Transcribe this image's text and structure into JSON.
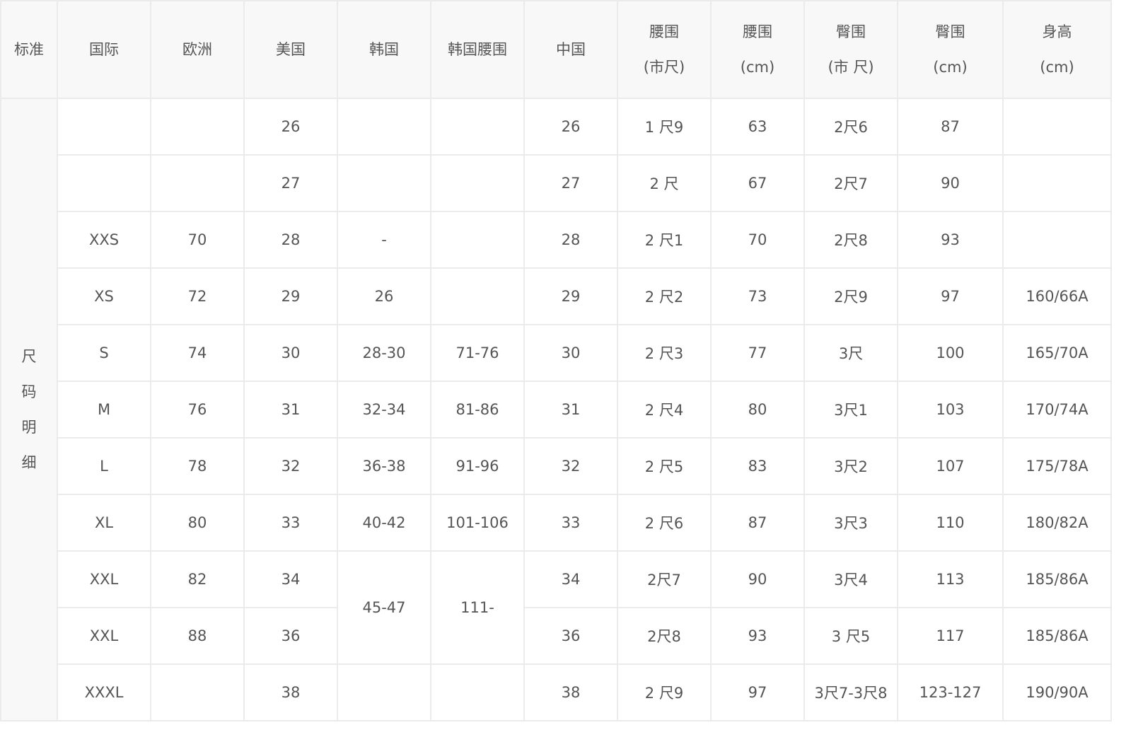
{
  "headers": [
    {
      "line1": "标准"
    },
    {
      "line1": "国际"
    },
    {
      "line1": "欧洲"
    },
    {
      "line1": "美国"
    },
    {
      "line1": "韩国"
    },
    {
      "line1": "韩国腰围"
    },
    {
      "line1": "中国"
    },
    {
      "line1": "腰围",
      "line2": "(市尺)"
    },
    {
      "line1": "腰围",
      "line2": "(cm)"
    },
    {
      "line1": "臀围",
      "line2": "(市 尺)"
    },
    {
      "line1": "臀围",
      "line2": "(cm)"
    },
    {
      "line1": "身高",
      "line2": "(cm)"
    }
  ],
  "side_label": [
    "尺",
    "码",
    "明",
    "细"
  ],
  "rows": [
    {
      "intl": "",
      "eu": "",
      "us": "26",
      "kr": "",
      "kr_waist": "",
      "cn": "26",
      "waist_chi": "1 尺9",
      "waist_cm": "63",
      "hip_chi": "2尺6",
      "hip_cm": "87",
      "height": ""
    },
    {
      "intl": "",
      "eu": "",
      "us": "27",
      "kr": "",
      "kr_waist": "",
      "cn": "27",
      "waist_chi": "2 尺",
      "waist_cm": "67",
      "hip_chi": "2尺7",
      "hip_cm": "90",
      "height": ""
    },
    {
      "intl": "XXS",
      "eu": "70",
      "us": "28",
      "kr": "-",
      "kr_waist": "",
      "cn": "28",
      "waist_chi": "2 尺1",
      "waist_cm": "70",
      "hip_chi": "2尺8",
      "hip_cm": "93",
      "height": ""
    },
    {
      "intl": "XS",
      "eu": "72",
      "us": "29",
      "kr": "26",
      "kr_waist": "",
      "cn": "29",
      "waist_chi": "2 尺2",
      "waist_cm": "73",
      "hip_chi": "2尺9",
      "hip_cm": "97",
      "height": "160/66A"
    },
    {
      "intl": "S",
      "eu": "74",
      "us": "30",
      "kr": "28-30",
      "kr_waist": "71-76",
      "cn": "30",
      "waist_chi": "2 尺3",
      "waist_cm": "77",
      "hip_chi": "3尺",
      "hip_cm": "100",
      "height": "165/70A"
    },
    {
      "intl": "M",
      "eu": "76",
      "us": "31",
      "kr": "32-34",
      "kr_waist": "81-86",
      "cn": "31",
      "waist_chi": "2 尺4",
      "waist_cm": "80",
      "hip_chi": "3尺1",
      "hip_cm": "103",
      "height": "170/74A"
    },
    {
      "intl": "L",
      "eu": "78",
      "us": "32",
      "kr": "36-38",
      "kr_waist": "91-96",
      "cn": "32",
      "waist_chi": "2 尺5",
      "waist_cm": "83",
      "hip_chi": "3尺2",
      "hip_cm": "107",
      "height": "175/78A"
    },
    {
      "intl": "XL",
      "eu": "80",
      "us": "33",
      "kr": "40-42",
      "kr_waist": "101-106",
      "cn": "33",
      "waist_chi": "2 尺6",
      "waist_cm": "87",
      "hip_chi": "3尺3",
      "hip_cm": "110",
      "height": "180/82A"
    },
    {
      "intl": "XXL",
      "eu": "82",
      "us": "34",
      "kr": "45-47",
      "kr_waist": "111-",
      "cn": "34",
      "waist_chi": "2尺7",
      "waist_cm": "90",
      "hip_chi": "3尺4",
      "hip_cm": "113",
      "height": "185/86A"
    },
    {
      "intl": "XXL",
      "eu": "88",
      "us": "36",
      "cn": "36",
      "waist_chi": "2尺8",
      "waist_cm": "93",
      "hip_chi": "3 尺5",
      "hip_cm": "117",
      "height": "185/86A"
    },
    {
      "intl": "XXXL",
      "eu": "",
      "us": "38",
      "kr": "",
      "kr_waist": "",
      "cn": "38",
      "waist_chi": "2 尺9",
      "waist_cm": "97",
      "hip_chi": "3尺7-3尺8",
      "hip_cm": "123-127",
      "height": "190/90A"
    }
  ]
}
